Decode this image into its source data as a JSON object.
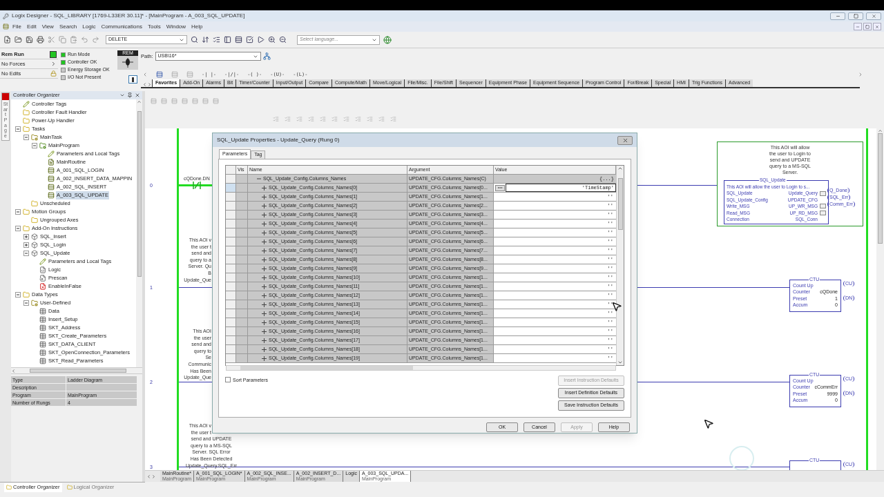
{
  "window": {
    "title": "Logix Designer - SQL_LIBRARY [1769-L33ER 30.11]* - [MainProgram - A_003_SQL_UPDATE]"
  },
  "menu": [
    "File",
    "Edit",
    "View",
    "Search",
    "Logic",
    "Communications",
    "Tools",
    "Window",
    "Help"
  ],
  "toolbar": {
    "search_combo": "DELETE",
    "language_combo": {
      "placeholder": "Select language..."
    }
  },
  "controller_status": {
    "mode": "Rem Run",
    "forces": "No Forces",
    "edits": "No Edits",
    "key_label": "REM",
    "lights": [
      {
        "label": "Run Mode",
        "on": true
      },
      {
        "label": "Controller OK",
        "on": true
      },
      {
        "label": "Energy Storage OK",
        "on": false
      },
      {
        "label": "I/O Not Present",
        "on": false
      }
    ]
  },
  "path": {
    "label": "Path:",
    "value": "USB\\16*"
  },
  "instruction_buttons": [
    "-| |-",
    "-|/|-",
    "-( )-",
    "-(U)-",
    "-(L)-"
  ],
  "instruction_tabs": [
    {
      "label": "Favorites",
      "selected": true
    },
    {
      "label": "Add-On",
      "selected": false
    },
    {
      "label": "Alarms",
      "selected": false
    },
    {
      "label": "Bit",
      "selected": false
    },
    {
      "label": "Timer/Counter",
      "selected": false
    },
    {
      "label": "Input/Output",
      "selected": false
    },
    {
      "label": "Compare",
      "selected": false
    },
    {
      "label": "Compute/Math",
      "selected": false
    },
    {
      "label": "Move/Logical",
      "selected": false
    },
    {
      "label": "File/Misc.",
      "selected": false
    },
    {
      "label": "File/Shift",
      "selected": false
    },
    {
      "label": "Sequencer",
      "selected": false
    },
    {
      "label": "Equipment Phase",
      "selected": false
    },
    {
      "label": "Equipment Sequence",
      "selected": false
    },
    {
      "label": "Program Control",
      "selected": false
    },
    {
      "label": "For/Break",
      "selected": false
    },
    {
      "label": "Special",
      "selected": false
    },
    {
      "label": "HMI",
      "selected": false
    },
    {
      "label": "Trig Functions",
      "selected": false
    },
    {
      "label": "Advanced",
      "selected": false
    }
  ],
  "organizer": {
    "title": "Controller Organizer",
    "start_page": "Start Page",
    "tree": [
      {
        "label": "Controller Tags",
        "kind": "tags",
        "selected": false
      },
      {
        "label": "Controller Fault Handler",
        "kind": "folder",
        "selected": false
      },
      {
        "label": "Power-Up Handler",
        "kind": "folder",
        "selected": false
      },
      {
        "label": "Tasks",
        "kind": "folder",
        "selected": false,
        "expanded": true,
        "children": [
          {
            "label": "MainTask",
            "kind": "task",
            "selected": false,
            "expanded": true,
            "children": [
              {
                "label": "MainProgram",
                "kind": "program",
                "selected": false,
                "expanded": true,
                "children": [
                  {
                    "label": "Parameters and Local Tags",
                    "kind": "tags",
                    "selected": false
                  },
                  {
                    "label": "MainRoutine",
                    "kind": "main_routine",
                    "selected": false
                  },
                  {
                    "label": "A_001_SQL_LOGIN",
                    "kind": "routine",
                    "selected": false
                  },
                  {
                    "label": "A_002_INSERT_DATA_MAPPIN",
                    "kind": "routine",
                    "selected": false
                  },
                  {
                    "label": "A_002_SQL_INSERT",
                    "kind": "routine",
                    "selected": false
                  },
                  {
                    "label": "A_003_SQL_UPDATE",
                    "kind": "routine",
                    "selected": true
                  }
                ]
              }
            ]
          },
          {
            "label": "Unscheduled",
            "kind": "folder",
            "selected": false
          }
        ]
      },
      {
        "label": "Motion Groups",
        "kind": "folder",
        "selected": false,
        "expanded": true,
        "children": [
          {
            "label": "Ungrouped Axes",
            "kind": "folder",
            "selected": false
          }
        ]
      },
      {
        "label": "Add-On Instructions",
        "kind": "folder",
        "selected": false,
        "expanded": true,
        "children": [
          {
            "label": "SQL_Insert",
            "kind": "aoi",
            "selected": false,
            "expanded": false
          },
          {
            "label": "SQL_Login",
            "kind": "aoi",
            "selected": false,
            "expanded": false
          },
          {
            "label": "SQL_Update",
            "kind": "aoi",
            "selected": false,
            "expanded": true,
            "children": [
              {
                "label": "Parameters and Local Tags",
                "kind": "tags",
                "selected": false
              },
              {
                "label": "Logic",
                "kind": "logic",
                "selected": false
              },
              {
                "label": "Prescan",
                "kind": "prescan",
                "selected": false
              },
              {
                "label": "EnableInFalse",
                "kind": "enable_false",
                "selected": false
              }
            ]
          }
        ]
      },
      {
        "label": "Data Types",
        "kind": "folder",
        "selected": false,
        "expanded": true,
        "children": [
          {
            "label": "User-Defined",
            "kind": "task",
            "selected": false,
            "expanded": true,
            "children": [
              {
                "label": "Data",
                "kind": "datatype",
                "selected": false
              },
              {
                "label": "Insert_Setup",
                "kind": "datatype",
                "selected": false
              },
              {
                "label": "SKT_Address",
                "kind": "datatype",
                "selected": false
              },
              {
                "label": "SKT_Create_Parameters",
                "kind": "datatype",
                "selected": false
              },
              {
                "label": "SKT_DATA_CLIENT",
                "kind": "datatype",
                "selected": false
              },
              {
                "label": "SKT_OpenConnection_Parameters",
                "kind": "datatype",
                "selected": false
              },
              {
                "label": "SKT_Read_Parameters",
                "kind": "datatype",
                "selected": false
              }
            ]
          }
        ]
      }
    ],
    "properties": [
      {
        "name": "Type",
        "value": "Ladder Diagram"
      },
      {
        "name": "Description"
      },
      {
        "name": "Program",
        "value": "MainProgram"
      },
      {
        "name": "Number of Rungs",
        "value": "4"
      }
    ],
    "tabs": [
      {
        "label": "Controller Organizer",
        "selected": true
      },
      {
        "label": "Logical Organizer",
        "selected": false
      }
    ]
  },
  "ladder": {
    "rung_numbers": [
      "0",
      "1",
      "2",
      "3"
    ],
    "contact": {
      "tag": "cQDone.DN",
      "energized": true
    },
    "comments": [
      {
        "lines": [
          "This AOI v",
          "the user t",
          "send and",
          "query to a",
          "Server. Qu",
          "B"
        ],
        "tag": "Update_Que"
      },
      {
        "lines": [
          "This AOI",
          "the user",
          "send and",
          "query to",
          "Se",
          "Communic",
          "Has Been"
        ],
        "tag": "Update_Que"
      },
      {
        "lines": [
          "This AOI v",
          "the user t",
          "send and UPDATE",
          "query to a MS-SQL",
          "Server. SQL Error",
          "Has Been Detected"
        ],
        "tag": "Update_Query.SQL_Err"
      }
    ],
    "aoi": {
      "comment": [
        "This AOI will allow",
        "the user to Login to",
        "send and UPDATE",
        "query to a MS-SQL",
        "Server."
      ],
      "name": "SQL_Update",
      "description": "This AOI will allow the user to Login to s...",
      "params": [
        {
          "name": "SQL_Update",
          "value": "Update_Query",
          "browse": true
        },
        {
          "name": "SQL_Update_Config",
          "value": "UPDATE_CFG",
          "browse": false
        },
        {
          "name": "Write_MSG",
          "value": "UP_WR_MSG",
          "browse": true
        },
        {
          "name": "Read_MSG",
          "value": "UP_RD_MSG",
          "browse": true
        },
        {
          "name": "Connection",
          "value": "SQL_Conn",
          "browse": false
        }
      ],
      "outputs": [
        "Q_Done",
        "SQL_Err",
        "Comm_Err"
      ]
    },
    "counters": [
      {
        "type": "CTU",
        "title": "Count Up",
        "rows": [
          {
            "name": "Counter",
            "value": "cQDone"
          },
          {
            "name": "Preset",
            "value": "1"
          },
          {
            "name": "Accum",
            "value": "0"
          }
        ],
        "outputs": [
          "CU",
          "DN"
        ]
      },
      {
        "type": "CTU",
        "title": "Count Up",
        "rows": [
          {
            "name": "Counter",
            "value": "cCommErr"
          },
          {
            "name": "Preset",
            "value": "9999"
          },
          {
            "name": "Accum",
            "value": "0"
          }
        ],
        "outputs": [
          "CU",
          "DN"
        ]
      },
      {
        "type": "CTU",
        "outputs": [
          "CU"
        ]
      }
    ]
  },
  "routine_tabs": [
    {
      "label": "MainRoutine*",
      "program": "MainProgram",
      "selected": false
    },
    {
      "label": "A_001_SQL_LOGIN*",
      "program": "MainProgram",
      "selected": false
    },
    {
      "label": "A_002_SQL_INSE...",
      "program": "MainProgram",
      "selected": false
    },
    {
      "label": "A_002_INSERT_D...",
      "program": "MainProgram",
      "selected": false
    },
    {
      "label": "Logic",
      "selected": false
    },
    {
      "label": "A_003_SQL_UPDA...",
      "program": "MainProgram",
      "selected": true
    }
  ],
  "dialog": {
    "title": "SQL_Update Properties - Update_Query (Rung 0)",
    "tabs": [
      {
        "label": "Parameters",
        "selected": true
      },
      {
        "label": "Tag",
        "selected": false
      }
    ],
    "columns": [
      "Vis",
      "Name",
      "Argument",
      "Value"
    ],
    "group": {
      "name": "SQL_Update_Config.Columns_Names",
      "argument": "UPDATE_CFG.Columns_Names(C)",
      "value": "{...}",
      "expanded": true
    },
    "rows": [
      {
        "name": "SQL_Update_Config.Columns_Names[0]",
        "argument": "UPDATE_CFG.Columns_Names[0...",
        "value": "'TimeStamp'",
        "selected": true
      },
      {
        "name": "SQL_Update_Config.Columns_Names[1]",
        "argument": "UPDATE_CFG.Columns_Names[1...",
        "value": "''",
        "selected": false
      },
      {
        "name": "SQL_Update_Config.Columns_Names[2]",
        "argument": "UPDATE_CFG.Columns_Names[2...",
        "value": "''",
        "selected": false
      },
      {
        "name": "SQL_Update_Config.Columns_Names[3]",
        "argument": "UPDATE_CFG.Columns_Names[3...",
        "value": "''",
        "selected": false
      },
      {
        "name": "SQL_Update_Config.Columns_Names[4]",
        "argument": "UPDATE_CFG.Columns_Names[4...",
        "value": "''",
        "selected": false
      },
      {
        "name": "SQL_Update_Config.Columns_Names[5]",
        "argument": "UPDATE_CFG.Columns_Names[5...",
        "value": "''",
        "selected": false
      },
      {
        "name": "SQL_Update_Config.Columns_Names[6]",
        "argument": "UPDATE_CFG.Columns_Names[6...",
        "value": "''",
        "selected": false
      },
      {
        "name": "SQL_Update_Config.Columns_Names[7]",
        "argument": "UPDATE_CFG.Columns_Names[7...",
        "value": "''",
        "selected": false
      },
      {
        "name": "SQL_Update_Config.Columns_Names[8]",
        "argument": "UPDATE_CFG.Columns_Names[8...",
        "value": "''",
        "selected": false
      },
      {
        "name": "SQL_Update_Config.Columns_Names[9]",
        "argument": "UPDATE_CFG.Columns_Names[9...",
        "value": "''",
        "selected": false
      },
      {
        "name": "SQL_Update_Config.Columns_Names[10]",
        "argument": "UPDATE_CFG.Columns_Names[1...",
        "value": "''",
        "selected": false
      },
      {
        "name": "SQL_Update_Config.Columns_Names[11]",
        "argument": "UPDATE_CFG.Columns_Names[1...",
        "value": "''",
        "selected": false
      },
      {
        "name": "SQL_Update_Config.Columns_Names[12]",
        "argument": "UPDATE_CFG.Columns_Names[1...",
        "value": "''",
        "selected": false
      },
      {
        "name": "SQL_Update_Config.Columns_Names[13]",
        "argument": "UPDATE_CFG.Columns_Names[1...",
        "value": "''",
        "selected": false
      },
      {
        "name": "SQL_Update_Config.Columns_Names[14]",
        "argument": "UPDATE_CFG.Columns_Names[1...",
        "value": "''",
        "selected": false
      },
      {
        "name": "SQL_Update_Config.Columns_Names[15]",
        "argument": "UPDATE_CFG.Columns_Names[1...",
        "value": "''",
        "selected": false
      },
      {
        "name": "SQL_Update_Config.Columns_Names[16]",
        "argument": "UPDATE_CFG.Columns_Names[1...",
        "value": "''",
        "selected": false
      },
      {
        "name": "SQL_Update_Config.Columns_Names[17]",
        "argument": "UPDATE_CFG.Columns_Names[1...",
        "value": "''",
        "selected": false
      },
      {
        "name": "SQL_Update_Config.Columns_Names[18]",
        "argument": "UPDATE_CFG.Columns_Names[1...",
        "value": "''",
        "selected": false
      },
      {
        "name": "SQL_Update_Config.Columns_Names[19]",
        "argument": "UPDATE_CFG.Columns_Names[1...",
        "value": "''",
        "selected": false
      }
    ],
    "sort": {
      "label": "Sort Parameters",
      "checked": false
    },
    "side_buttons": [
      {
        "label": "Insert Instruction Defaults",
        "disabled": true
      },
      {
        "label": "Insert Definition Defaults",
        "disabled": false
      },
      {
        "label": "Save Instruction Defaults",
        "disabled": false
      }
    ],
    "buttons": [
      {
        "label": "OK",
        "disabled": false
      },
      {
        "label": "Cancel",
        "disabled": false
      },
      {
        "label": "Apply",
        "disabled": true
      },
      {
        "label": "Help",
        "disabled": false
      }
    ]
  }
}
